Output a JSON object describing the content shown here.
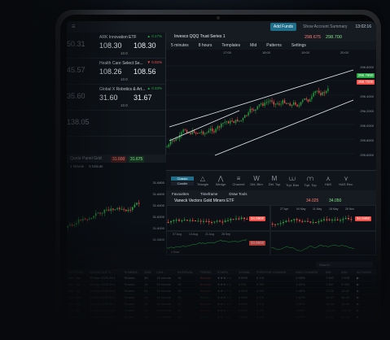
{
  "topbar": {
    "brand": "",
    "add_funds": "Add Funds",
    "account_summary": "Show Account Summary",
    "clock": "13:02:16"
  },
  "watchlist": [
    {
      "left": "50.31",
      "name": "ARK Innovation ETF",
      "chg": "▲ 0.17%",
      "bid": "108.30",
      "ask": "108.30",
      "spread": "10.0",
      "dir": "up"
    },
    {
      "left": "45.57",
      "name": "Health Care Select Se...",
      "chg": "▼ 0.02%",
      "bid": "108.26",
      "ask": "108.56",
      "spread": "10.0",
      "dir": "down"
    },
    {
      "left": "35.60",
      "name": "Global X Robotics & Art...",
      "chg": "▲ 0.33%",
      "bid": "31.60",
      "ask": "31.67",
      "spread": "10.0",
      "dir": "up"
    },
    {
      "left": "138.05",
      "name": "",
      "chg": "",
      "bid": "",
      "ask": "",
      "spread": "",
      "dir": "up"
    }
  ],
  "quote_panel": {
    "title": "Quote Panel Grid",
    "price_sell": "31.600",
    "price_buy": "31.675",
    "tab1": "1 Minute",
    "tab2": "5 Minute",
    "y_ticks": [
      "31.6800",
      "31.6600",
      "31.6400",
      "31.6200",
      "31.6000",
      "31.5800"
    ]
  },
  "main_chart": {
    "title": "Invesco QQQ Trust Series 1",
    "sell": "298.675",
    "buy": "298.700",
    "toolbar": [
      "5 minutes",
      "8 hours",
      "Templates",
      "Mid",
      "Patterns",
      "Settings"
    ],
    "y_ticks": [
      "296.8000",
      "296.6000",
      "296.4000",
      "296.2000",
      "296.0000",
      "295.8000",
      "295.6000"
    ],
    "x_ticks": [
      "17:00",
      "18:00",
      "19:00",
      "20:00"
    ],
    "tag_last": "296.7000",
    "tag_high": "296.7950"
  },
  "tools": {
    "items": [
      {
        "label": "Triangle",
        "icon": "triangle-icon",
        "glyph": "△"
      },
      {
        "label": "Wedge",
        "icon": "wedge-icon",
        "glyph": "⋀"
      },
      {
        "label": "Channel",
        "icon": "channel-icon",
        "glyph": "≡"
      },
      {
        "label": "Dbl. Btm",
        "icon": "double-bottom-icon",
        "glyph": "W"
      },
      {
        "label": "Dbl. Top",
        "icon": "double-top-icon",
        "glyph": "M"
      },
      {
        "label": "Trpl. Btm",
        "icon": "triple-bottom-icon",
        "glyph": "⩊"
      },
      {
        "label": "Trpl. Top",
        "icon": "triple-top-icon",
        "glyph": "⩋"
      },
      {
        "label": "H&S",
        "icon": "head-shoulders-icon",
        "glyph": "⋏"
      },
      {
        "label": "H&S Rev.",
        "icon": "head-shoulders-rev-icon",
        "glyph": "⋎"
      }
    ],
    "mode1": "Classic",
    "mode2": "Candle",
    "sub": [
      "Favourites",
      "Timeframe",
      "Draw Tools"
    ]
  },
  "bottom_chart": {
    "title": "Vaneck Vectors Gold Miners ETF",
    "sell": "34.025",
    "buy": "34.050",
    "labels": [
      "27 Apr",
      "04 May",
      "11 May",
      "18 May",
      "26 Nov",
      "07 Aug",
      "14 Aug",
      "21 Aug",
      "28 Sep",
      "1 Hour"
    ],
    "tag1": "34.0500",
    "tag2": "34.0450",
    "tag3": "33.9600"
  },
  "table": {
    "search": "Search",
    "headers": [
      "PATTERN",
      "BREAKOUT T...",
      "SYMBOL",
      "SIZE",
      "LEN...",
      "INTERVAL",
      "TREND",
      "STARS",
      "SIGNAL",
      "POSITIVE CHANGE",
      "MAX CHANGE",
      "BID",
      "ASK",
      "ACTIONS"
    ],
    "rows": [
      [
        "Dbl. Top",
        "20 Nov 2020 20:1",
        "Shares",
        "30",
        "15 minute",
        "15",
        "Bearish",
        "★★★☆☆",
        "0.55%",
        "0.1%",
        "0.93%",
        "7.947",
        "7.975",
        "▶"
      ],
      [
        "Dbl. Top",
        "20 Nov 2020 20:1",
        "Shares",
        "16",
        "15 minute",
        "15",
        "Bearish",
        "★★★☆☆",
        "1.2%",
        "0.3%",
        "1.05%",
        "7.847",
        "9.050",
        "▶"
      ],
      [
        "Dbl. Top",
        "20 Nov 2020 20:1",
        "Shares",
        "51",
        "15 minute",
        "15",
        "Bearish",
        "★★☆☆☆",
        "0.41%",
        "0.3%",
        "0.48%",
        "13.56",
        "13.60",
        "▶"
      ],
      [
        "Dbl. Btm",
        "20 Nov 2020 20:1",
        "Shares",
        "14",
        "15 minute",
        "15",
        "Bullish",
        "★★★☆☆",
        "0.56%",
        "0.1%",
        "0.62%",
        "26.47",
        "26.49",
        "▶"
      ],
      [
        "Dbl. Top",
        "20 Nov 2020 20:1",
        "Shares",
        "23",
        "15 minute",
        "15",
        "Bearish",
        "★★☆☆☆",
        "0.33%",
        "0.1%",
        "0.40%",
        "18.64",
        "18.66",
        "▶"
      ],
      [
        "Dbl. Top",
        "20 Nov 2020 20:1",
        "Shares",
        "32",
        "15 minute",
        "15",
        "Bearish",
        "★★★☆☆",
        "0.92%",
        "0.2%",
        "0.68%",
        "114.37",
        "114.45",
        "▶"
      ],
      [
        "Dbl. Btm",
        "20 Nov 2020 20:1",
        "Shares",
        "19",
        "15 minute",
        "15",
        "Bullish",
        "★★☆☆☆",
        "0.20%",
        "0.1%",
        "0.26%",
        "51.52",
        "51.56",
        "▶"
      ]
    ]
  },
  "colors": {
    "up": "#26a641",
    "down": "#f85149",
    "accent": "#1f6f8b"
  }
}
